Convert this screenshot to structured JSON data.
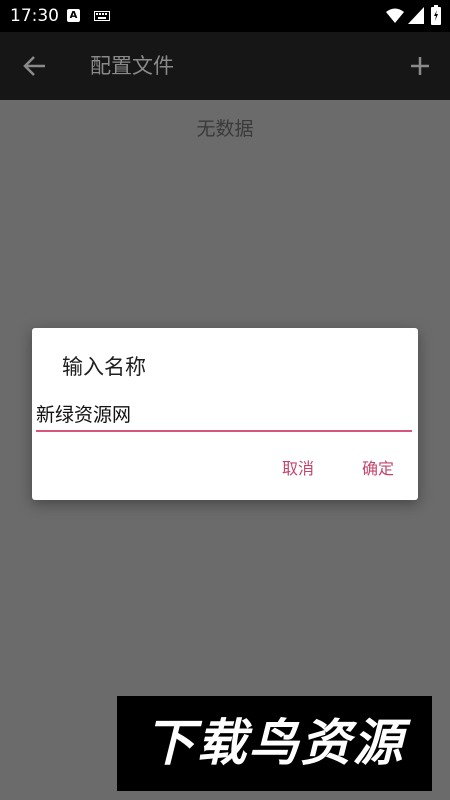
{
  "status_bar": {
    "time": "17:30",
    "notification_icon_letter": "A",
    "icons": [
      "a-notification-icon",
      "keyboard-icon",
      "wifi-icon",
      "signal-icon",
      "battery-icon"
    ]
  },
  "toolbar": {
    "title": "配置文件",
    "back_icon": "arrow-left-icon",
    "add_icon": "plus-icon",
    "background_color": "#161616",
    "title_color": "#8a8a8a"
  },
  "content": {
    "empty_text": "无数据"
  },
  "dialog": {
    "title": "输入名称",
    "input_value": "新绿资源网",
    "cancel_label": "取消",
    "ok_label": "确定",
    "accent_color": "#c4456b"
  },
  "watermark": {
    "text": "下载鸟资源"
  }
}
